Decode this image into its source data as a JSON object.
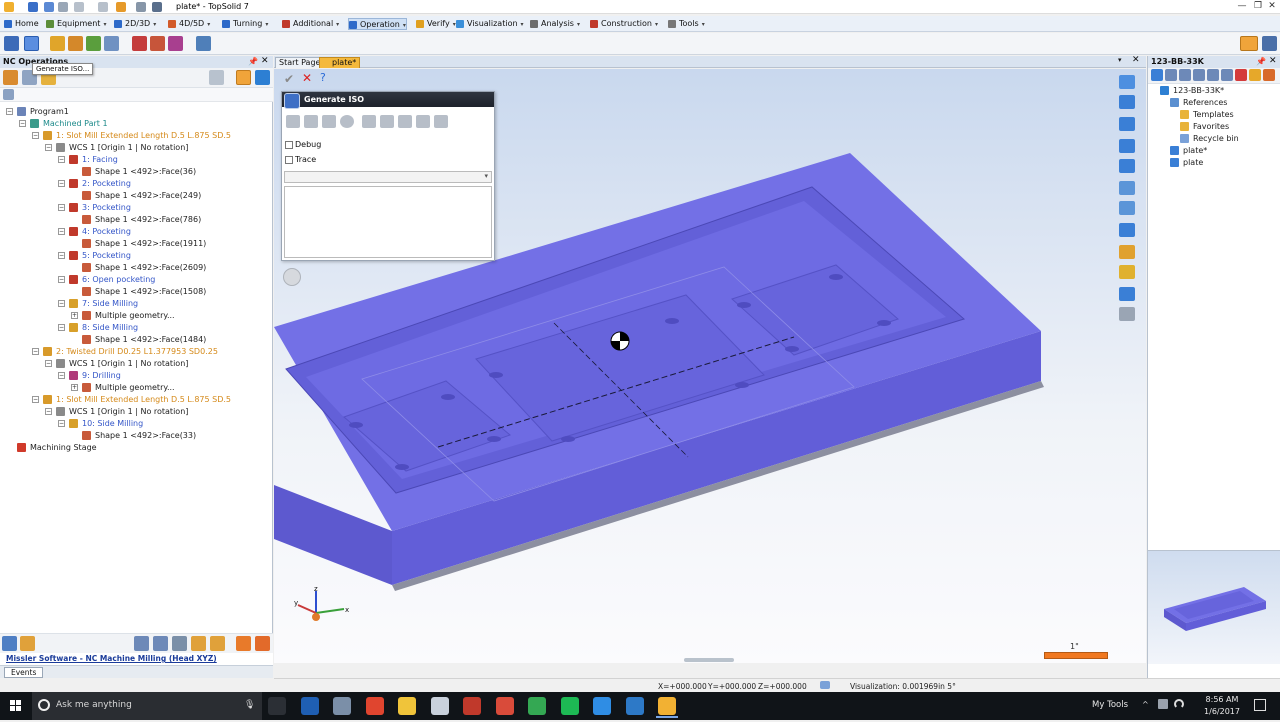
{
  "window": {
    "title": "plate* - TopSolid 7",
    "minimize": "—",
    "maximize": "❐",
    "close": "✕"
  },
  "menu": [
    {
      "label": "Home",
      "color": "#2c69c9"
    },
    {
      "label": "Equipment",
      "color": "#5b8d3a"
    },
    {
      "label": "2D/3D",
      "color": "#2c69c9"
    },
    {
      "label": "4D/5D",
      "color": "#d25a2a"
    },
    {
      "label": "Turning",
      "color": "#2c69c9"
    },
    {
      "label": "Additional",
      "color": "#c0392b"
    },
    {
      "label": "Operation",
      "color": "#2c69c9"
    },
    {
      "label": "Verify",
      "color": "#e0a020"
    },
    {
      "label": "Visualization",
      "color": "#3a8fd9"
    },
    {
      "label": "Analysis",
      "color": "#6d6d6d"
    },
    {
      "label": "Construction",
      "color": "#c0392b"
    },
    {
      "label": "Tools",
      "color": "#777777"
    }
  ],
  "left_panel": {
    "title": "NC Operations",
    "tooltip": "Generate ISO...",
    "tree": [
      {
        "label": "Program1",
        "indent": 0,
        "color": "black",
        "icon": "program-icon",
        "toggle": "−"
      },
      {
        "label": "Machined Part 1",
        "indent": 1,
        "color": "teal",
        "icon": "part-icon",
        "toggle": "−"
      },
      {
        "label": "1: Slot Mill Extended Length D.5 L.875 SD.5",
        "indent": 2,
        "color": "orange",
        "icon": "tool-icon",
        "toggle": "−"
      },
      {
        "label": "WCS 1 [Origin 1 | No rotation]",
        "indent": 3,
        "color": "black",
        "icon": "wcs-icon",
        "toggle": "−"
      },
      {
        "label": "1: Facing",
        "indent": 4,
        "color": "blue",
        "icon": "operation-icon",
        "toggle": "−"
      },
      {
        "label": "Shape 1 <492>:Face(36)",
        "indent": 5,
        "color": "black",
        "icon": "shape-icon",
        "toggle": ""
      },
      {
        "label": "2: Pocketing",
        "indent": 4,
        "color": "blue",
        "icon": "operation-icon",
        "toggle": "−"
      },
      {
        "label": "Shape 1 <492>:Face(249)",
        "indent": 5,
        "color": "black",
        "icon": "shape-icon",
        "toggle": ""
      },
      {
        "label": "3: Pocketing",
        "indent": 4,
        "color": "blue",
        "icon": "operation-icon",
        "toggle": "−"
      },
      {
        "label": "Shape 1 <492>:Face(786)",
        "indent": 5,
        "color": "black",
        "icon": "shape-icon",
        "toggle": ""
      },
      {
        "label": "4: Pocketing",
        "indent": 4,
        "color": "blue",
        "icon": "operation-icon",
        "toggle": "−"
      },
      {
        "label": "Shape 1 <492>:Face(1911)",
        "indent": 5,
        "color": "black",
        "icon": "shape-icon",
        "toggle": ""
      },
      {
        "label": "5: Pocketing",
        "indent": 4,
        "color": "blue",
        "icon": "operation-icon",
        "toggle": "−"
      },
      {
        "label": "Shape 1 <492>:Face(2609)",
        "indent": 5,
        "color": "black",
        "icon": "shape-icon",
        "toggle": ""
      },
      {
        "label": "6: Open pocketing",
        "indent": 4,
        "color": "blue",
        "icon": "operation-icon",
        "toggle": "−"
      },
      {
        "label": "Shape 1 <492>:Face(1508)",
        "indent": 5,
        "color": "black",
        "icon": "shape-icon",
        "toggle": ""
      },
      {
        "label": "7: Side Milling",
        "indent": 4,
        "color": "blue",
        "icon": "side-milling-icon",
        "toggle": "−"
      },
      {
        "label": "Multiple geometry...",
        "indent": 5,
        "color": "black",
        "icon": "shape-icon",
        "toggle": "+"
      },
      {
        "label": "8: Side Milling",
        "indent": 4,
        "color": "blue",
        "icon": "side-milling-icon",
        "toggle": "−"
      },
      {
        "label": "Shape 1 <492>:Face(1484)",
        "indent": 5,
        "color": "black",
        "icon": "shape-icon",
        "toggle": ""
      },
      {
        "label": "2: Twisted Drill D0.25 L1.377953 SD0.25",
        "indent": 2,
        "color": "orange",
        "icon": "tool-icon",
        "toggle": "−"
      },
      {
        "label": "WCS 1 [Origin 1 | No rotation]",
        "indent": 3,
        "color": "black",
        "icon": "wcs-icon",
        "toggle": "−"
      },
      {
        "label": "9: Drilling",
        "indent": 4,
        "color": "blue",
        "icon": "drilling-icon",
        "toggle": "−"
      },
      {
        "label": "Multiple geometry...",
        "indent": 5,
        "color": "black",
        "icon": "shape-icon",
        "toggle": "+"
      },
      {
        "label": "1: Slot Mill Extended Length D.5 L.875 SD.5",
        "indent": 2,
        "color": "orange",
        "icon": "tool-icon",
        "toggle": "−"
      },
      {
        "label": "WCS 1 [Origin 1 | No rotation]",
        "indent": 3,
        "color": "black",
        "icon": "wcs-icon",
        "toggle": "−"
      },
      {
        "label": "10: Side Milling",
        "indent": 4,
        "color": "blue",
        "icon": "side-milling-icon",
        "toggle": "−"
      },
      {
        "label": "Shape 1 <492>:Face(33)",
        "indent": 5,
        "color": "black",
        "icon": "shape-icon",
        "toggle": ""
      },
      {
        "label": "Machining Stage",
        "indent": 0,
        "color": "black",
        "icon": "stage-arrow-icon",
        "toggle": ""
      }
    ],
    "status_link": "Missler Software - NC Machine Milling (Head XYZ)",
    "events_tab": "Events"
  },
  "doc_tabs": [
    {
      "label": "Start Page",
      "active": false
    },
    {
      "label": "plate*",
      "active": true
    }
  ],
  "dialog": {
    "title": "Generate ISO",
    "debug_label": "Debug",
    "trace_label": "Trace",
    "combo_value": "",
    "output_text": ""
  },
  "viewport": {
    "scale_label": "1\"",
    "axis_x": "x",
    "axis_y": "y",
    "axis_z": "z",
    "part_color": "#6c68e0",
    "part_top_color": "#7471e8"
  },
  "right_panel": {
    "title": "123-BB-33K",
    "tree": [
      {
        "label": "123-BB-33K*",
        "indent": 0,
        "icon": "project-icon"
      },
      {
        "label": "References",
        "indent": 1,
        "icon": "references-icon"
      },
      {
        "label": "Templates",
        "indent": 2,
        "icon": "folder-icon"
      },
      {
        "label": "Favorites",
        "indent": 2,
        "icon": "folder-icon"
      },
      {
        "label": "Recycle bin",
        "indent": 2,
        "icon": "recycle-bin-icon"
      },
      {
        "label": "plate*",
        "indent": 1,
        "icon": "part-doc-icon"
      },
      {
        "label": "plate",
        "indent": 1,
        "icon": "part-doc-icon"
      }
    ]
  },
  "status_bar": {
    "x": "X=+000.000",
    "y": "Y=+000.000",
    "z": "Z=+000.000",
    "visualization": "Visualization: 0.001969in 5°"
  },
  "taskbar": {
    "search_placeholder": "Ask me anything",
    "my_tools": "My Tools",
    "time": "8:56 AM",
    "date": "1/6/2017",
    "apps": [
      {
        "name": "task-view",
        "color": "#2b2f35"
      },
      {
        "name": "outlook",
        "color": "#1f5fb3"
      },
      {
        "name": "notepad-app",
        "color": "#7b8fa8"
      },
      {
        "name": "chrome",
        "color": "#e0452f"
      },
      {
        "name": "file-explorer",
        "color": "#f0c43a"
      },
      {
        "name": "pdf-app",
        "color": "#c9d1dc"
      },
      {
        "name": "filezilla",
        "color": "#c0392b"
      },
      {
        "name": "red-app",
        "color": "#d94b3a"
      },
      {
        "name": "camtasia",
        "color": "#34a853"
      },
      {
        "name": "spotify",
        "color": "#1db954"
      },
      {
        "name": "skype",
        "color": "#2f8de4"
      },
      {
        "name": "blue-arrow-app",
        "color": "#2d79c7"
      },
      {
        "name": "topsolid-app",
        "color": "#f2b133"
      }
    ]
  }
}
